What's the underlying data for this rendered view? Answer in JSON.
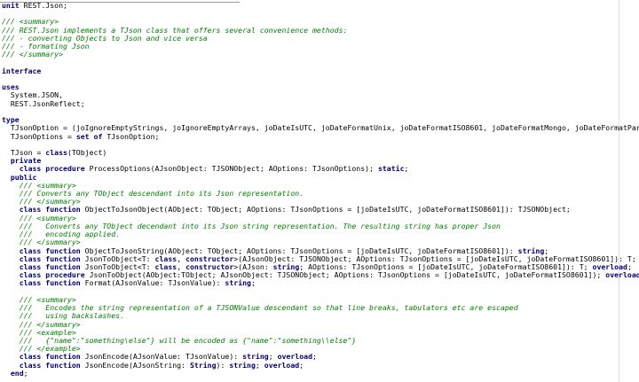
{
  "colors": {
    "background": "#ffffff",
    "keyword": "#000080",
    "comment": "#008000",
    "text": "#000000"
  },
  "code_lines": [
    [
      {
        "k": "kw",
        "t": "unit"
      },
      {
        "k": "tx",
        "t": " REST.Json;"
      }
    ],
    [],
    [
      {
        "k": "cm",
        "t": "/// <summary>"
      }
    ],
    [
      {
        "k": "cm",
        "t": "/// REST.Json implements a TJson class that offers several convenience methods:"
      }
    ],
    [
      {
        "k": "cm",
        "t": "/// - converting Objects to Json and vice versa"
      }
    ],
    [
      {
        "k": "cm",
        "t": "/// - formating Json"
      }
    ],
    [
      {
        "k": "cm",
        "t": "/// </summary>"
      }
    ],
    [],
    [
      {
        "k": "kw",
        "t": "interface"
      }
    ],
    [],
    [
      {
        "k": "kw",
        "t": "uses"
      }
    ],
    [
      {
        "k": "tx",
        "t": "  System.JSON,"
      }
    ],
    [
      {
        "k": "tx",
        "t": "  REST.JsonReflect;"
      }
    ],
    [],
    [
      {
        "k": "kw",
        "t": "type"
      }
    ],
    [
      {
        "k": "tx",
        "t": "  TJsonOption = (joIgnoreEmptyStrings, joIgnoreEmptyArrays, joDateIsUTC, joDateFormatUnix, joDateFormatISO8601, joDateFormatMongo, joDateFormatParse);"
      }
    ],
    [
      {
        "k": "tx",
        "t": "  TJsonOptions = "
      },
      {
        "k": "kw",
        "t": "set of"
      },
      {
        "k": "tx",
        "t": " TJsonOption;"
      }
    ],
    [],
    [
      {
        "k": "tx",
        "t": "  TJson = "
      },
      {
        "k": "kw",
        "t": "class"
      },
      {
        "k": "tx",
        "t": "(TObject)"
      }
    ],
    [
      {
        "k": "tx",
        "t": "  "
      },
      {
        "k": "kw",
        "t": "private"
      }
    ],
    [
      {
        "k": "tx",
        "t": "    "
      },
      {
        "k": "kw",
        "t": "class procedure"
      },
      {
        "k": "tx",
        "t": " ProcessOptions(AJsonObject: TJSONObject; AOptions: TJsonOptions); "
      },
      {
        "k": "kw",
        "t": "static"
      },
      {
        "k": "tx",
        "t": ";"
      }
    ],
    [
      {
        "k": "tx",
        "t": "  "
      },
      {
        "k": "kw",
        "t": "public"
      }
    ],
    [
      {
        "k": "tx",
        "t": "    "
      },
      {
        "k": "cm",
        "t": "/// <summary>"
      }
    ],
    [
      {
        "k": "tx",
        "t": "    "
      },
      {
        "k": "cm",
        "t": "/// Converts any TObject descendant into its Json representation."
      }
    ],
    [
      {
        "k": "tx",
        "t": "    "
      },
      {
        "k": "cm",
        "t": "/// </summary>"
      }
    ],
    [
      {
        "k": "tx",
        "t": "    "
      },
      {
        "k": "kw",
        "t": "class function"
      },
      {
        "k": "tx",
        "t": " ObjectToJsonObject(AObject: TObject; AOptions: TJsonOptions = [joDateIsUTC, joDateFormatISO8601]): TJSONObject;"
      }
    ],
    [
      {
        "k": "tx",
        "t": "    "
      },
      {
        "k": "cm",
        "t": "/// <summary>"
      }
    ],
    [
      {
        "k": "tx",
        "t": "    "
      },
      {
        "k": "cm",
        "t": "///   Converts any TObject decendant into its Json string representation. The resulting string has proper Json"
      }
    ],
    [
      {
        "k": "tx",
        "t": "    "
      },
      {
        "k": "cm",
        "t": "///   encoding applied."
      }
    ],
    [
      {
        "k": "tx",
        "t": "    "
      },
      {
        "k": "cm",
        "t": "/// </summary>"
      }
    ],
    [
      {
        "k": "tx",
        "t": "    "
      },
      {
        "k": "kw",
        "t": "class function"
      },
      {
        "k": "tx",
        "t": " ObjectToJsonString(AObject: TObject; AOptions: TJsonOptions = [joDateIsUTC, joDateFormatISO8601]): "
      },
      {
        "k": "kw",
        "t": "string"
      },
      {
        "k": "tx",
        "t": ";"
      }
    ],
    [
      {
        "k": "tx",
        "t": "    "
      },
      {
        "k": "kw",
        "t": "class function"
      },
      {
        "k": "tx",
        "t": " JsonToObject<T: "
      },
      {
        "k": "kw",
        "t": "class"
      },
      {
        "k": "tx",
        "t": ", "
      },
      {
        "k": "kw",
        "t": "constructor"
      },
      {
        "k": "tx",
        "t": ">(AJsonObject: TJSONObject; AOptions: TJsonOptions = [joDateIsUTC, joDateFormatISO8601]): T; "
      },
      {
        "k": "kw",
        "t": "overload"
      },
      {
        "k": "tx",
        "t": ";"
      }
    ],
    [
      {
        "k": "tx",
        "t": "    "
      },
      {
        "k": "kw",
        "t": "class function"
      },
      {
        "k": "tx",
        "t": " JsonToObject<T: "
      },
      {
        "k": "kw",
        "t": "class"
      },
      {
        "k": "tx",
        "t": ", "
      },
      {
        "k": "kw",
        "t": "constructor"
      },
      {
        "k": "tx",
        "t": ">(AJson: "
      },
      {
        "k": "kw",
        "t": "string"
      },
      {
        "k": "tx",
        "t": "; AOptions: TJsonOptions = [joDateIsUTC, joDateFormatISO8601]): T; "
      },
      {
        "k": "kw",
        "t": "overload"
      },
      {
        "k": "tx",
        "t": ";"
      }
    ],
    [
      {
        "k": "tx",
        "t": "    "
      },
      {
        "k": "kw",
        "t": "class procedure"
      },
      {
        "k": "tx",
        "t": " JsonToObject(AObject:TObject; AJsonObject: TJSONObject; AOptions: TJsonOptions = [joDateIsUTC, joDateFormatISO8601]); "
      },
      {
        "k": "kw",
        "t": "overload"
      },
      {
        "k": "tx",
        "t": ";"
      }
    ],
    [
      {
        "k": "tx",
        "t": "    "
      },
      {
        "k": "kw",
        "t": "class function"
      },
      {
        "k": "tx",
        "t": " Format(AJsonValue: TJsonValue): "
      },
      {
        "k": "kw",
        "t": "string"
      },
      {
        "k": "tx",
        "t": ";"
      }
    ],
    [],
    [
      {
        "k": "tx",
        "t": "    "
      },
      {
        "k": "cm",
        "t": "/// <summary>"
      }
    ],
    [
      {
        "k": "tx",
        "t": "    "
      },
      {
        "k": "cm",
        "t": "///   Encodes the string representation of a TJSONValue descendant so that line breaks, tabulators etc are escaped"
      }
    ],
    [
      {
        "k": "tx",
        "t": "    "
      },
      {
        "k": "cm",
        "t": "///   using backslashes."
      }
    ],
    [
      {
        "k": "tx",
        "t": "    "
      },
      {
        "k": "cm",
        "t": "/// </summary>"
      }
    ],
    [
      {
        "k": "tx",
        "t": "    "
      },
      {
        "k": "cm",
        "t": "/// <example>"
      }
    ],
    [
      {
        "k": "tx",
        "t": "    "
      },
      {
        "k": "cm",
        "t": "///   {\"name\":\"something\\else\"} will be encoded as {\"name\":\"something\\\\else\"}"
      }
    ],
    [
      {
        "k": "tx",
        "t": "    "
      },
      {
        "k": "cm",
        "t": "/// </example>"
      }
    ],
    [
      {
        "k": "tx",
        "t": "    "
      },
      {
        "k": "kw",
        "t": "class function"
      },
      {
        "k": "tx",
        "t": " JsonEncode(AJsonValue: TJsonValue): "
      },
      {
        "k": "kw",
        "t": "string"
      },
      {
        "k": "tx",
        "t": "; "
      },
      {
        "k": "kw",
        "t": "overload"
      },
      {
        "k": "tx",
        "t": ";"
      }
    ],
    [
      {
        "k": "tx",
        "t": "    "
      },
      {
        "k": "kw",
        "t": "class function"
      },
      {
        "k": "tx",
        "t": " JsonEncode(AJsonString: "
      },
      {
        "k": "kw",
        "t": "String"
      },
      {
        "k": "tx",
        "t": "): "
      },
      {
        "k": "kw",
        "t": "string"
      },
      {
        "k": "tx",
        "t": "; "
      },
      {
        "k": "kw",
        "t": "overload"
      },
      {
        "k": "tx",
        "t": ";"
      }
    ],
    [
      {
        "k": "tx",
        "t": "  "
      },
      {
        "k": "kw",
        "t": "end"
      },
      {
        "k": "tx",
        "t": ";"
      }
    ]
  ]
}
